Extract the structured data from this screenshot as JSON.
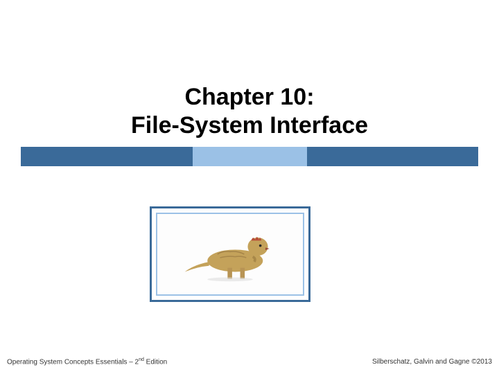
{
  "title": {
    "line1": "Chapter 10:",
    "line2": "File-System Interface"
  },
  "bar": {
    "colors": {
      "dark": "#3a6a99",
      "light": "#9bc1e6"
    }
  },
  "image": {
    "name": "dinosaur-illustration"
  },
  "footer": {
    "left_prefix": "Operating System Concepts Essentials – 2",
    "left_sup": "nd",
    "left_suffix": " Edition",
    "right": "Silberschatz, Galvin and Gagne ©2013"
  }
}
